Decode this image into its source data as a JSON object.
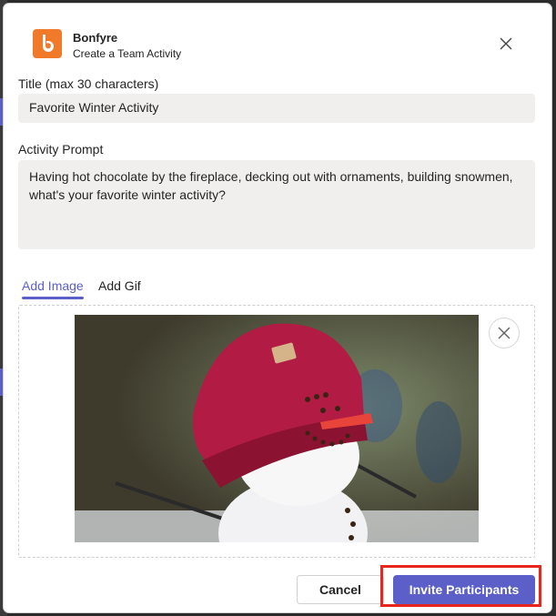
{
  "app": {
    "name": "Bonfyre",
    "subtitle": "Create a Team Activity",
    "brand_color": "#f07a2a"
  },
  "form": {
    "title_label": "Title (max 30 characters)",
    "title_value": "Favorite Winter Activity",
    "prompt_label": "Activity Prompt",
    "prompt_value": "Having hot chocolate by the fireplace, decking out with ornaments, building snowmen, what's your favorite winter activity?"
  },
  "tabs": [
    {
      "label": "Add Image",
      "active": true
    },
    {
      "label": "Add Gif",
      "active": false
    }
  ],
  "image": {
    "icon": "snowman-photo"
  },
  "footer": {
    "cancel_label": "Cancel",
    "primary_label": "Invite Participants"
  },
  "colors": {
    "accent": "#5b5fc7",
    "highlight": "#e8261c",
    "input_bg": "#f0efee"
  }
}
